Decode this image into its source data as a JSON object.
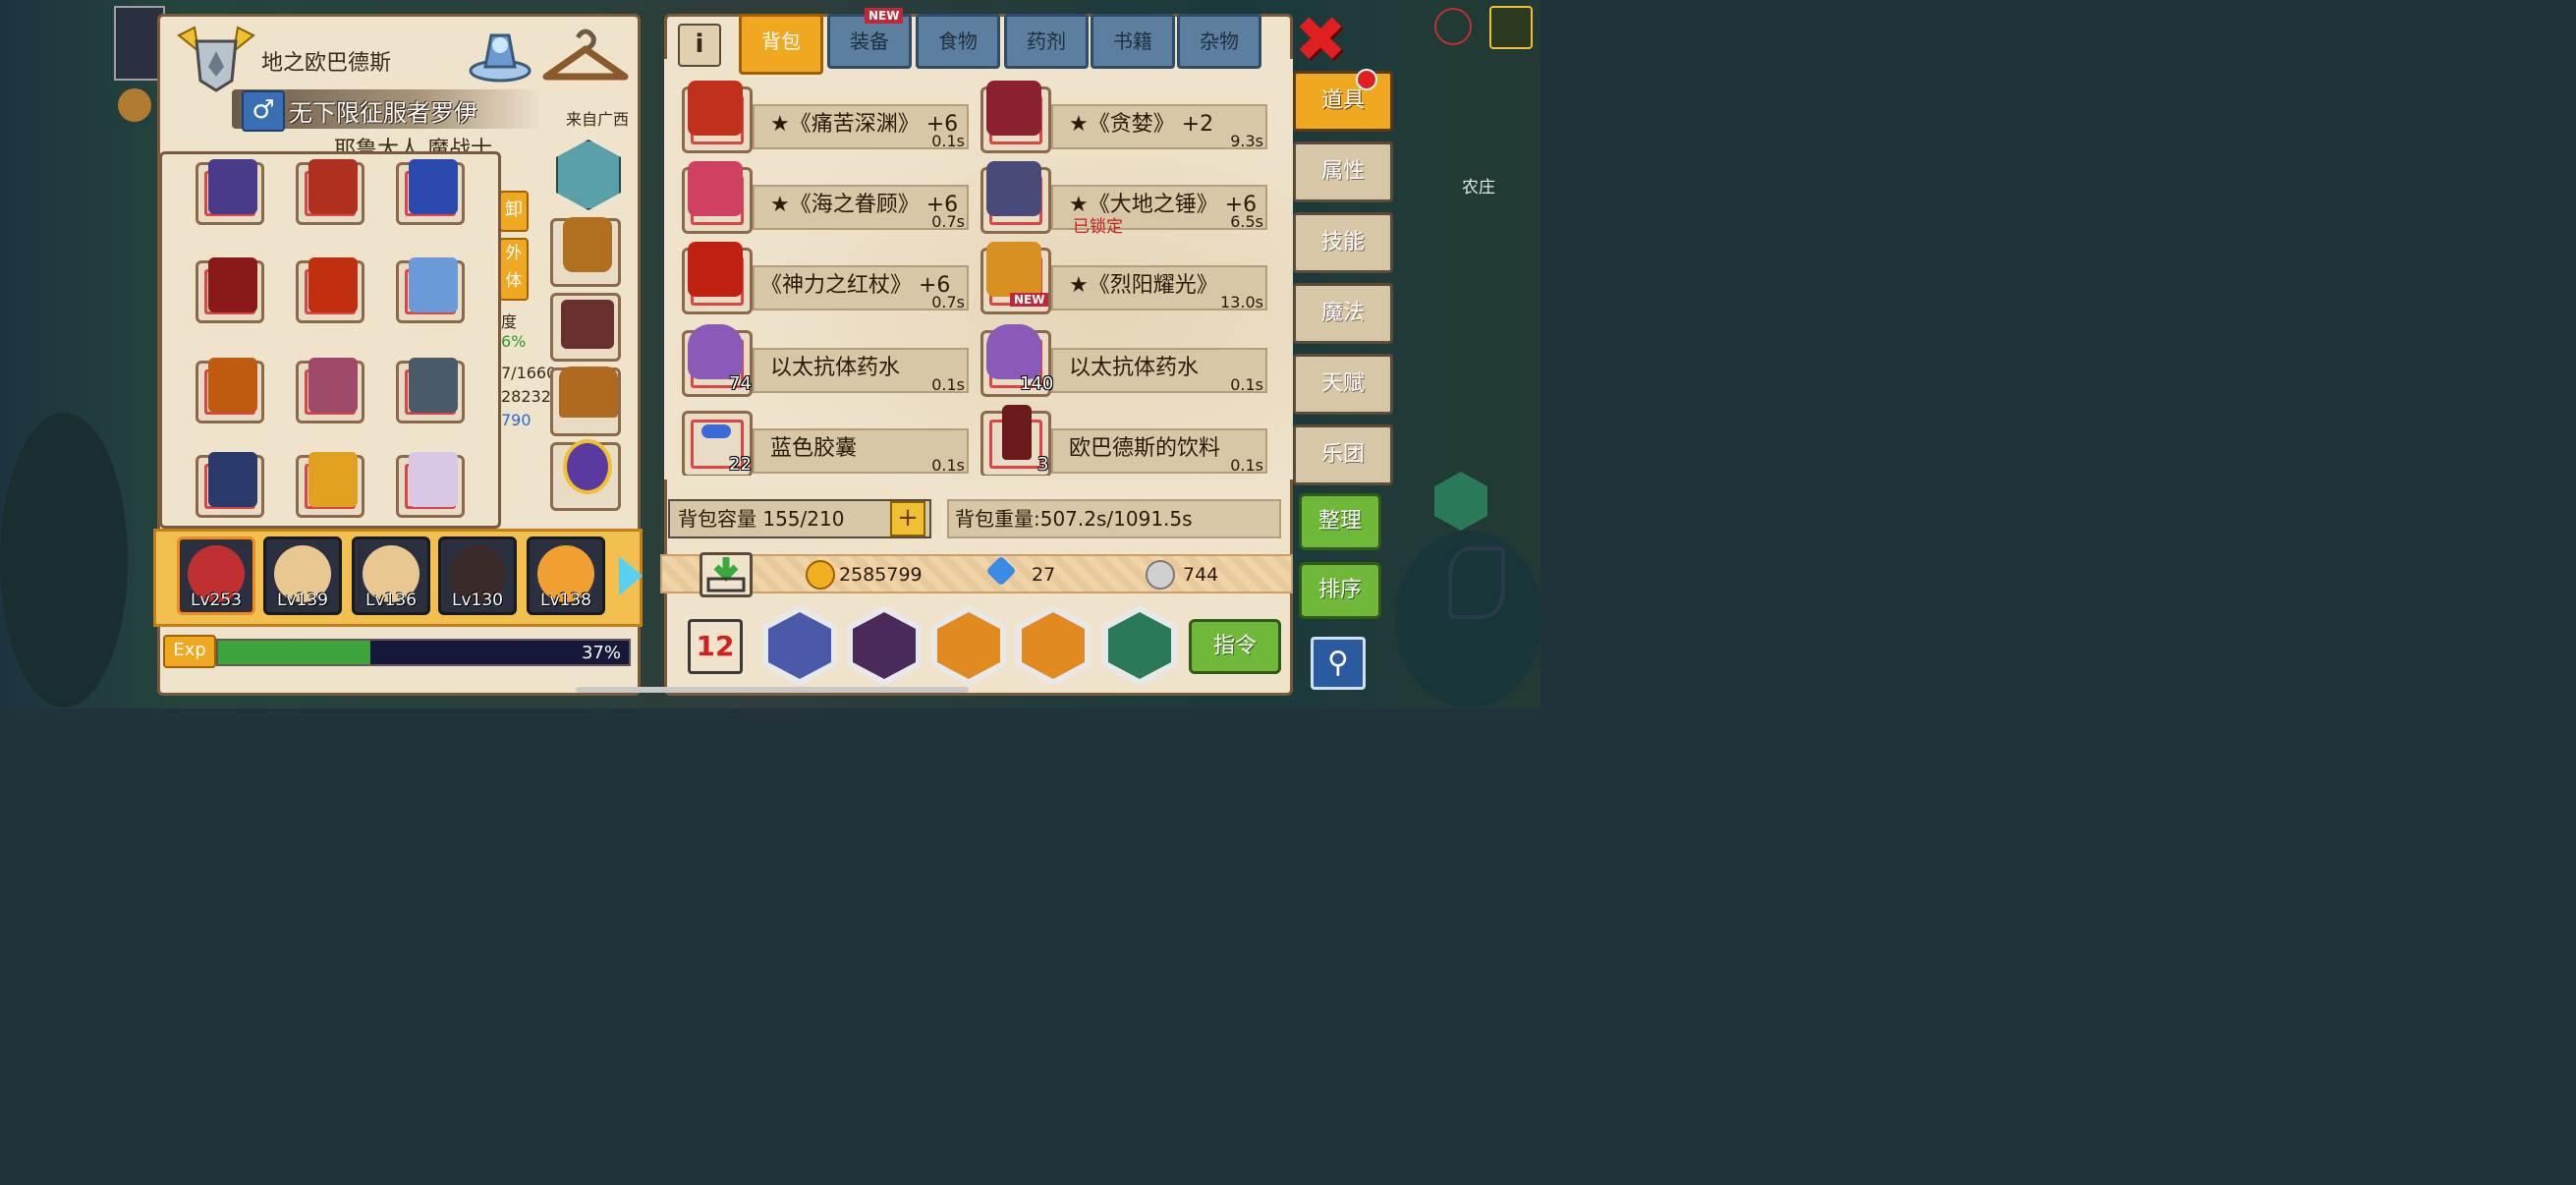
{
  "character": {
    "title": "地之欧巴德斯",
    "name": "无下限征服者罗伊",
    "gender_symbol": "♂",
    "origin": "来自广西",
    "subtitle": "耶鲁大人 魔战士",
    "side_peek": {
      "btn1": "卸",
      "btn2": "外体",
      "stat_label": "度",
      "stat_pct": "6%",
      "stat_a": "7/1660",
      "stat_b": "28232",
      "stat_c": "790"
    },
    "exp_label": "Exp",
    "exp_percent": "37%",
    "exp_value": 0.37
  },
  "heroes": [
    {
      "level": "Lv253",
      "selected": true
    },
    {
      "level": "Lv139",
      "selected": false
    },
    {
      "level": "Lv136",
      "selected": false
    },
    {
      "level": "Lv130",
      "selected": false
    },
    {
      "level": "Lv138",
      "selected": false
    }
  ],
  "inventory": {
    "tabs": [
      {
        "label": "背包",
        "active": true
      },
      {
        "label": "装备",
        "badge": "NEW"
      },
      {
        "label": "食物"
      },
      {
        "label": "药剂"
      },
      {
        "label": "书籍"
      },
      {
        "label": "杂物"
      }
    ],
    "items": [
      {
        "name": "★《痛苦深渊》 +6",
        "weight": "0.1s"
      },
      {
        "name": "★《贪婪》 +2",
        "weight": "9.3s"
      },
      {
        "name": "★《海之眷顾》 +6",
        "weight": "0.7s"
      },
      {
        "name": "★《大地之锤》 +6",
        "weight": "6.5s",
        "locked": "已锁定"
      },
      {
        "name": "《神力之红杖》 +6",
        "weight": "0.7s"
      },
      {
        "name": "★《烈阳耀光》",
        "weight": "13.0s",
        "tag": "NEW"
      },
      {
        "name": "以太抗体药水",
        "weight": "0.1s",
        "qty": "74"
      },
      {
        "name": "以太抗体药水",
        "weight": "0.1s",
        "qty": "140"
      },
      {
        "name": "蓝色胶囊",
        "weight": "0.1s",
        "qty": "22"
      },
      {
        "name": "欧巴德斯的饮料",
        "weight": "0.1s",
        "qty": "3"
      }
    ],
    "capacity": "背包容量 155/210",
    "weight": "背包重量:507.2s/1091.5s",
    "gold": "2585799",
    "diamonds": "27",
    "silver": "744",
    "command": "指令"
  },
  "side_nav": [
    {
      "label": "道具",
      "active": true
    },
    {
      "label": "属性"
    },
    {
      "label": "技能"
    },
    {
      "label": "魔法"
    },
    {
      "label": "天赋"
    },
    {
      "label": "乐团"
    }
  ],
  "actions": {
    "organize": "整理",
    "sort": "排序"
  },
  "map_label": "农庄",
  "colors": {
    "tab_active": "#f0a820",
    "tab_inactive": "#5c7fa0",
    "panel_bg": "#efe3cc",
    "green_button": "#6fb83a",
    "exp_fill": "#3da33a"
  }
}
